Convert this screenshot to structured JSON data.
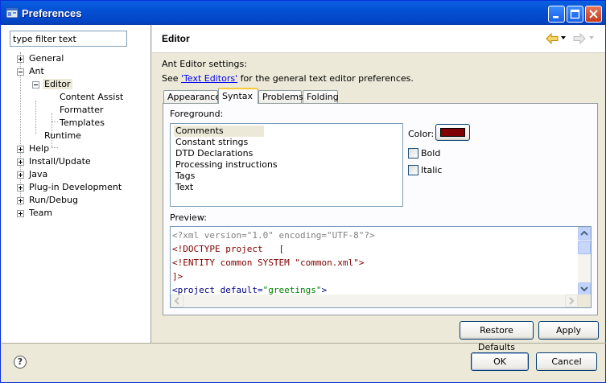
{
  "window": {
    "title": "Preferences"
  },
  "filter": {
    "value": "type filter text"
  },
  "tree": {
    "general": "General",
    "ant": "Ant",
    "editor": "Editor",
    "content_assist": "Content Assist",
    "formatter": "Formatter",
    "templates": "Templates",
    "runtime": "Runtime",
    "help": "Help",
    "install_update": "Install/Update",
    "java": "Java",
    "plugin_dev": "Plug-in Development",
    "run_debug": "Run/Debug",
    "team": "Team"
  },
  "page": {
    "title": "Editor",
    "settings_label": "Ant Editor settings:",
    "see_prefix": "See ",
    "see_link": "'Text Editors'",
    "see_suffix": " for the general text editor preferences."
  },
  "tabs": [
    "Appearance",
    "Syntax",
    "Problems",
    "Folding"
  ],
  "syntax": {
    "foreground_label": "Foreground:",
    "items": [
      "Comments",
      "Constant strings",
      "DTD Declarations",
      "Processing instructions",
      "Tags",
      "Text"
    ],
    "selected_item": "Comments",
    "color_label": "Color:",
    "color_value": "#800000",
    "bold_label": "Bold",
    "italic_label": "Italic",
    "preview_label": "Preview:"
  },
  "preview": {
    "line1": "<?xml version=\"1.0\" encoding=\"UTF-8\"?>",
    "line2": "<!DOCTYPE project   [",
    "line3_a": "<!ENTITY common SYSTEM ",
    "line3_b": "\"common.xml\"",
    "line3_c": ">",
    "line4": "]>",
    "line5_a": "<project default=",
    "line5_b": "\"greetings\"",
    "line5_c": ">"
  },
  "colors": {
    "pi": "#808080",
    "dtd": "#800000",
    "tag": "#000080",
    "string": "#008000"
  },
  "buttons": {
    "restore_defaults": "Restore Defaults",
    "apply": "Apply",
    "ok": "OK",
    "cancel": "Cancel"
  },
  "icons": {
    "back": "back-arrow-icon",
    "forward": "forward-arrow-icon",
    "help": "help-icon"
  }
}
